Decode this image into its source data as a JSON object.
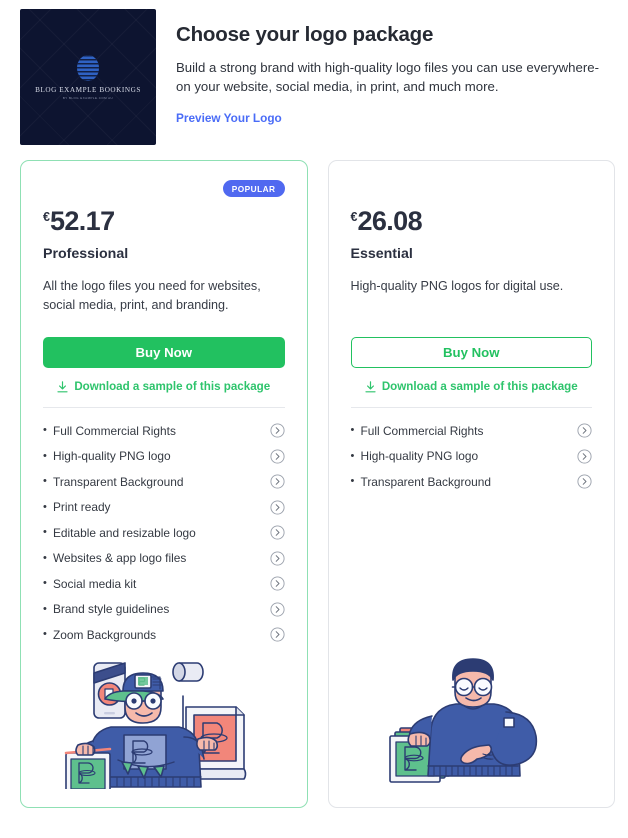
{
  "header": {
    "title": "Choose your logo package",
    "subtitle": "Build a strong brand with high-quality logo files you can use everywhere-on your website, social media, in print, and much more.",
    "preview_link": "Preview Your Logo",
    "logo_thumb": {
      "brand_name": "BLOG EXAMPLE BOOKINGS",
      "tagline": "BY BLOG EXAMPLE.COM AU",
      "background_color": "#0d1430",
      "globe_color": "#2f62c4",
      "icon": "globe-icon"
    },
    "link_color": "#4a6cf7"
  },
  "colors": {
    "green": "#22c160",
    "green_border": "#8fe0b4",
    "badge_blue": "#5069f0",
    "gray_border": "#e2e4e8"
  },
  "cards": [
    {
      "id": "professional",
      "badge": "POPULAR",
      "currency": "€",
      "price": "52.17",
      "plan_name": "Professional",
      "description": "All the logo files you need for websites, social media, print, and branding.",
      "buy_label": "Buy Now",
      "buy_style": "solid",
      "download_label": "Download a sample of this package",
      "features": [
        "Full Commercial Rights",
        "High-quality PNG logo",
        "Transparent Background",
        "Print ready",
        "Editable and resizable logo",
        "Websites & app logo files",
        "Social media kit",
        "Brand style guidelines",
        "Zoom Backgrounds"
      ],
      "illustration": "designer-with-branded-materials-illustration"
    },
    {
      "id": "essential",
      "badge": "",
      "currency": "€",
      "price": "26.08",
      "plan_name": "Essential",
      "description": "High-quality PNG logos for digital use.",
      "buy_label": "Buy Now",
      "buy_style": "outline",
      "download_label": "Download a sample of this package",
      "features": [
        "Full Commercial Rights",
        "High-quality PNG logo",
        "Transparent Background"
      ],
      "illustration": "designer-holding-print-samples-illustration"
    }
  ]
}
